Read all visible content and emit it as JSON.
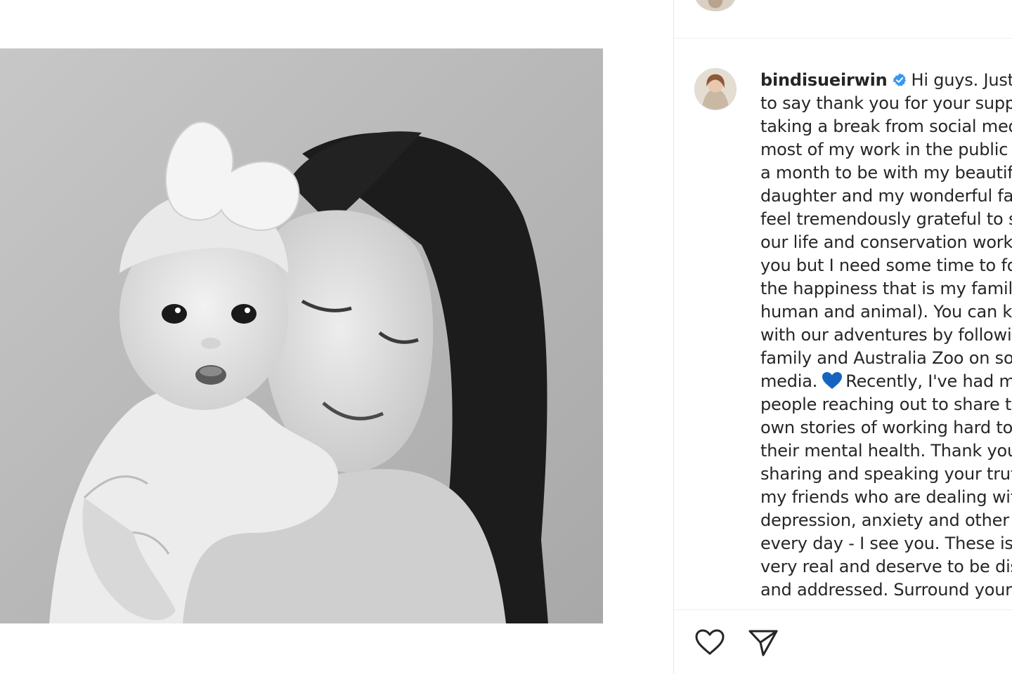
{
  "post": {
    "username": "bindisueirwin",
    "caption_lines": [
      "Hi guys. Just a",
      "to say thank you for your suppo",
      "taking a break from social med",
      "most of my work in the public e",
      "a month to be with my beautifu",
      "daughter and my wonderful fam",
      "feel tremendously grateful to sh",
      "our life and conservation work v",
      "you but I need some time to fo",
      "the happiness that is my family",
      "human and animal). You can ke",
      "with our adventures by followin",
      "family and Australia Zoo on soc",
      "media.",
      "Recently, I've had m",
      "people reaching out to share th",
      "own stories of working hard to",
      "their mental health. Thank you",
      "sharing and speaking your truth",
      "my friends who are dealing with",
      "depression, anxiety and other b",
      "every day - I see you. These issu",
      "very real and deserve to be disc",
      "and addressed. Surround yours"
    ]
  },
  "icons": {
    "verified": "verified-badge-icon",
    "blue_heart": "blue-heart-emoji-icon",
    "like": "heart-outline-icon",
    "share": "paper-plane-icon"
  },
  "colors": {
    "verified_blue": "#3897f0",
    "heart_blue": "#1565c0",
    "text": "#262626"
  }
}
